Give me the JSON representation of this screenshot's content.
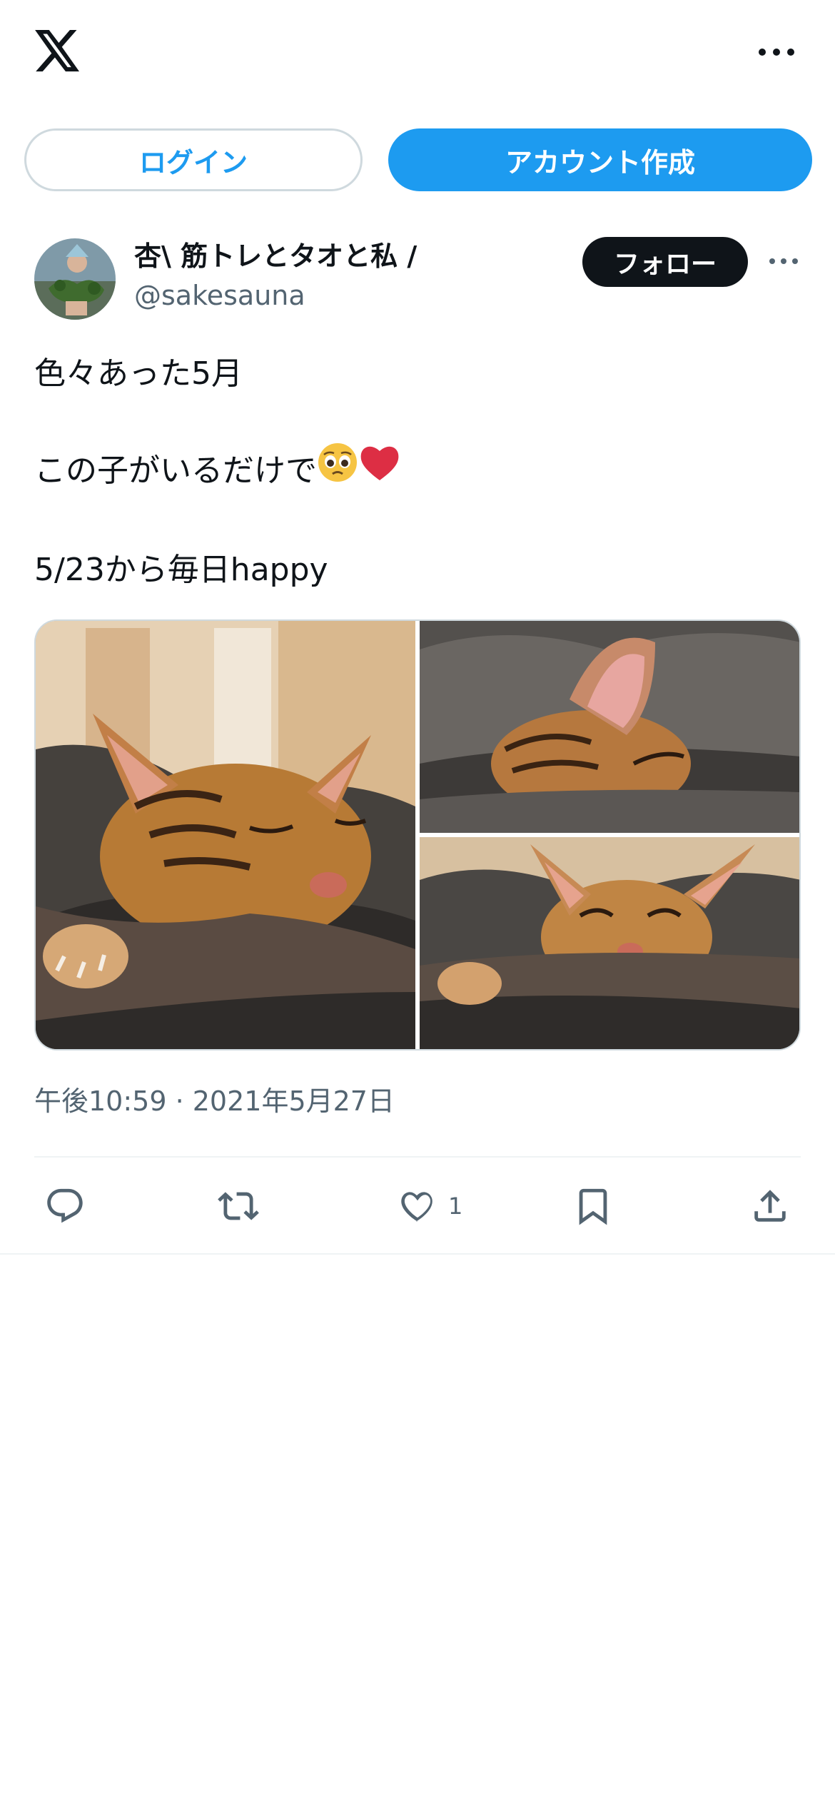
{
  "header": {
    "logo_icon": "x-logo-icon",
    "more_icon": "more-dots-icon"
  },
  "auth": {
    "login_label": "ログイン",
    "signup_label": "アカウント作成"
  },
  "post": {
    "author": {
      "display_name": "杏\\ 筋トレとタオと私 /",
      "handle": "@sakesauna"
    },
    "follow_label": "フォロー",
    "text_line1": "色々あった5月",
    "text_line2": "この子がいるだけで",
    "text_line3": "5/23から毎日happy",
    "emojis": [
      "pleading-face-emoji",
      "red-heart-emoji"
    ],
    "media": {
      "photo_count": 3,
      "description_icons": [
        "kitten-photo-1",
        "kitten-photo-2",
        "kitten-photo-3"
      ]
    },
    "timestamp": "午後10:59 · 2021年5月27日",
    "actions": {
      "reply_icon": "reply-icon",
      "repost_icon": "repost-icon",
      "like_icon": "heart-icon",
      "like_count": "1",
      "bookmark_icon": "bookmark-icon",
      "share_icon": "share-icon"
    }
  },
  "colors": {
    "accent": "#1d9bf0",
    "text": "#0f1419",
    "muted": "#536471",
    "border": "#cfd9de"
  }
}
